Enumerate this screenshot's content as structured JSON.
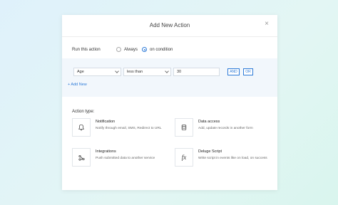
{
  "modal": {
    "title": "Add New Action",
    "close_glyph": "×"
  },
  "run": {
    "label": "Run this action",
    "options": [
      {
        "label": "Always",
        "selected": false
      },
      {
        "label": "on condition",
        "selected": true
      }
    ]
  },
  "condition": {
    "field": "Age",
    "operator": "less than",
    "value": "30",
    "and_label": "AND",
    "or_label": "OR",
    "add_new": "+ Add New"
  },
  "action_type": {
    "label": "Action type:",
    "cards": [
      {
        "icon": "bell-icon",
        "title": "Notification",
        "desc": "Notify through email, SMS, Redirect to URL"
      },
      {
        "icon": "database-icon",
        "title": "Data access",
        "desc": "Add, update records in another form"
      },
      {
        "icon": "integration-icon",
        "title": "Integrations",
        "desc": "Push submitted data to another service"
      },
      {
        "icon": "fx-icon",
        "title": "Deluge Script",
        "desc": "Write script in events like on load, on success",
        "glyph": "fx"
      }
    ]
  },
  "colors": {
    "accent": "#2e7bd8",
    "band": "#f2f7fc"
  }
}
